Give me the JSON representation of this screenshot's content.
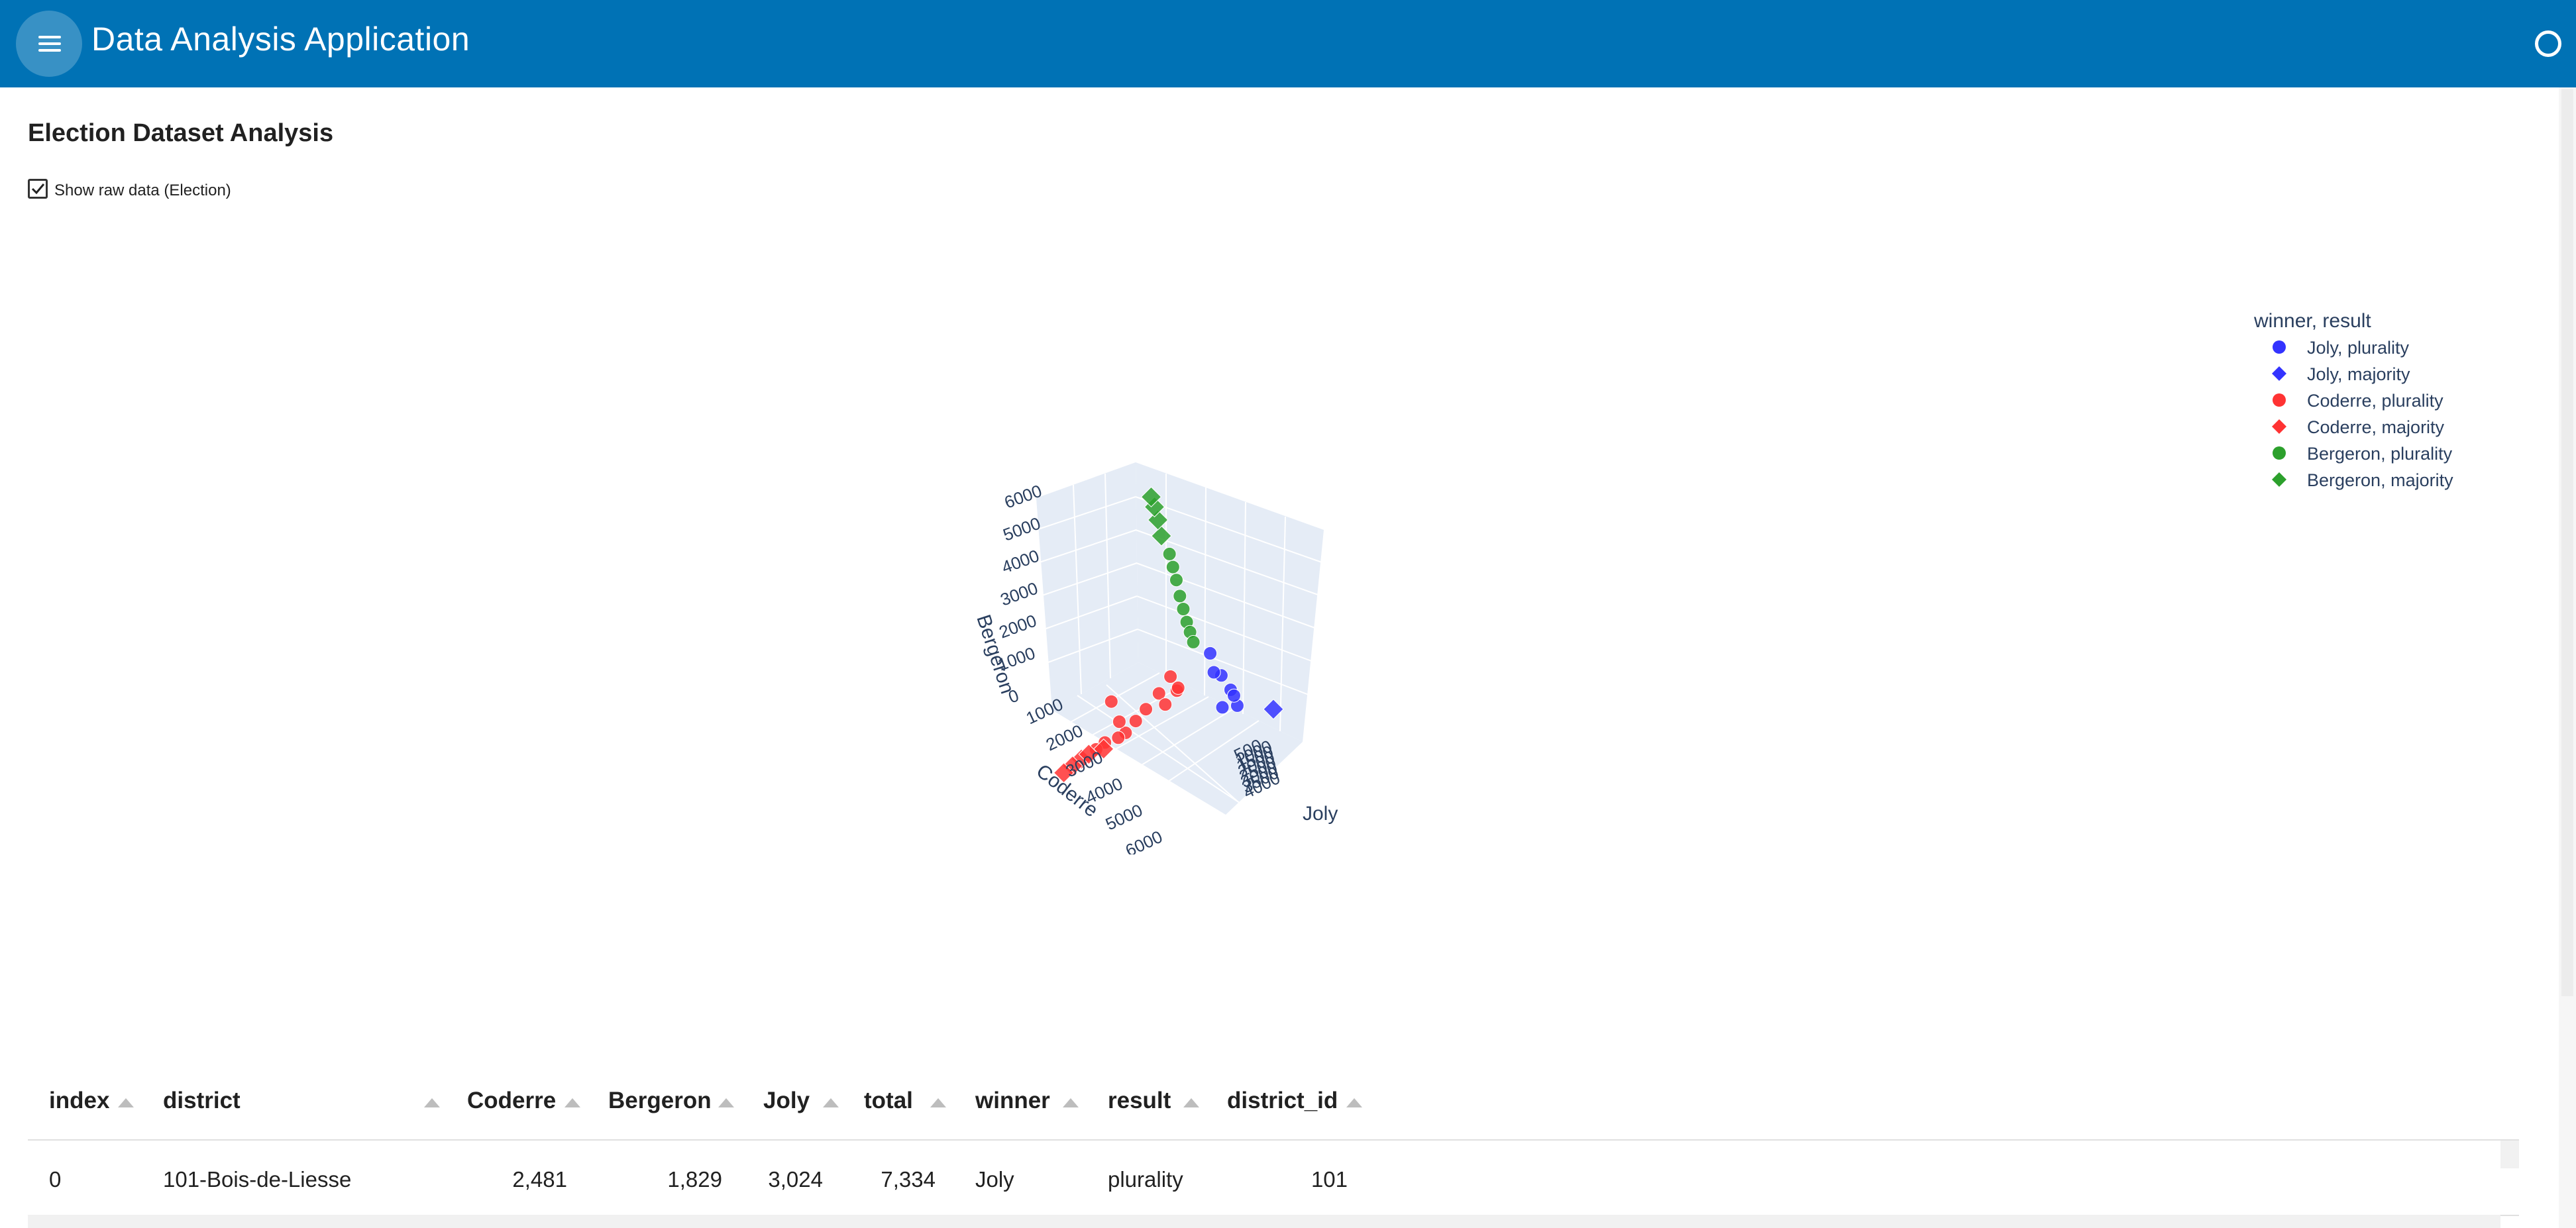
{
  "app": {
    "title": "Data Analysis Application"
  },
  "section": {
    "title": "Election Dataset Analysis"
  },
  "raw_toggle": {
    "label": "Show raw data (Election)",
    "checked": true
  },
  "chart_data": {
    "type": "scatter",
    "dimensions": "3d",
    "axes": {
      "x": {
        "label": "Joly",
        "ticks": [
          "500",
          "1000",
          "1500",
          "2000",
          "2500",
          "3000",
          "3500",
          "4000"
        ]
      },
      "y": {
        "label": "Coderre",
        "ticks": [
          "1000",
          "2000",
          "3000",
          "4000",
          "5000",
          "6000"
        ]
      },
      "z": {
        "label": "Bergeron",
        "ticks": [
          "0",
          "1000",
          "2000",
          "3000",
          "4000",
          "5000",
          "6000"
        ]
      }
    },
    "legend_title": "winner, result",
    "legend_position": "top-right",
    "series": [
      {
        "name": "Joly, plurality",
        "color": "#3333ff",
        "symbol": "circle",
        "points": [
          [
            2800,
            2400,
            2100
          ],
          [
            3024,
            2481,
            1829
          ],
          [
            2600,
            2300,
            2000
          ],
          [
            3200,
            2600,
            1500
          ],
          [
            2900,
            2700,
            1300
          ],
          [
            2500,
            2200,
            2500
          ],
          [
            3100,
            2500,
            1700
          ]
        ]
      },
      {
        "name": "Joly, majority",
        "color": "#3333ff",
        "symbol": "diamond",
        "points": [
          [
            3800,
            2000,
            1400
          ]
        ]
      },
      {
        "name": "Coderre, plurality",
        "color": "#ff3333",
        "symbol": "circle",
        "points": [
          [
            1900,
            3100,
            1900
          ],
          [
            2100,
            3300,
            1700
          ],
          [
            1800,
            3600,
            1600
          ],
          [
            2000,
            3800,
            1500
          ],
          [
            1700,
            4200,
            1400
          ],
          [
            1600,
            4600,
            1200
          ],
          [
            1500,
            5000,
            1000
          ],
          [
            1400,
            5200,
            900
          ],
          [
            1300,
            4800,
            1100
          ],
          [
            1200,
            5500,
            800
          ],
          [
            2200,
            3500,
            2000
          ],
          [
            1100,
            5800,
            700
          ],
          [
            1000,
            4400,
            1300
          ]
        ]
      },
      {
        "name": "Coderre, majority",
        "color": "#ff3333",
        "symbol": "diamond",
        "points": [
          [
            900,
            6200,
            500
          ],
          [
            800,
            6500,
            400
          ],
          [
            700,
            6800,
            300
          ],
          [
            1000,
            6000,
            600
          ],
          [
            1200,
            5600,
            650
          ]
        ]
      },
      {
        "name": "Bergeron, plurality",
        "color": "#2ca02c",
        "symbol": "circle",
        "points": [
          [
            2000,
            2200,
            3200
          ],
          [
            1900,
            2100,
            3500
          ],
          [
            1800,
            2000,
            3800
          ],
          [
            2100,
            2300,
            3000
          ],
          [
            1700,
            1900,
            4200
          ],
          [
            1600,
            1800,
            4500
          ],
          [
            2200,
            2400,
            2800
          ],
          [
            1500,
            1700,
            4800
          ]
        ]
      },
      {
        "name": "Bergeron, majority",
        "color": "#2ca02c",
        "symbol": "diamond",
        "points": [
          [
            1300,
            1600,
            5200
          ],
          [
            1200,
            1500,
            5600
          ],
          [
            1100,
            1400,
            5900
          ],
          [
            1000,
            1300,
            6100
          ]
        ]
      }
    ]
  },
  "table": {
    "columns": [
      "index",
      "district",
      "Coderre",
      "Bergeron",
      "Joly",
      "total",
      "winner",
      "result",
      "district_id"
    ],
    "rows": [
      [
        "0",
        "101-Bois-de-Liesse",
        "2,481",
        "1,829",
        "3,024",
        "7,334",
        "Joly",
        "plurality",
        "101"
      ]
    ]
  }
}
